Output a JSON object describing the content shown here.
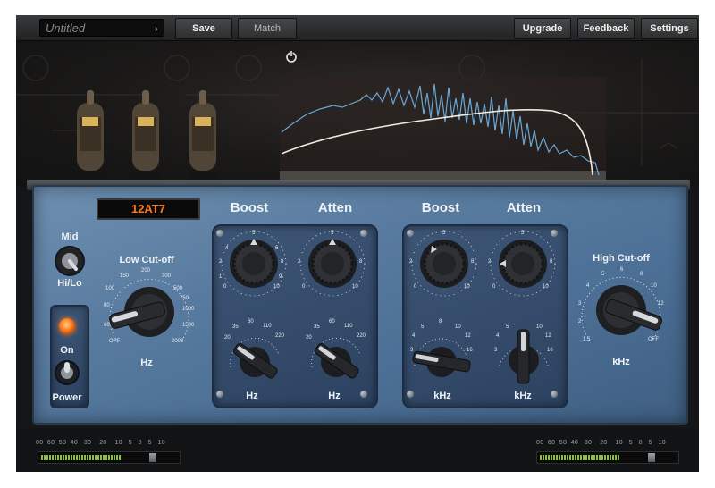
{
  "toolbar": {
    "preset_name": "Untitled",
    "save_label": "Save",
    "match_label": "Match",
    "upgrade_label": "Upgrade",
    "feedback_label": "Feedback",
    "settings_label": "Settings"
  },
  "tube_display": "12AT7",
  "mid_switch": {
    "top": "Mid",
    "bottom": "Hi/Lo"
  },
  "power": {
    "on_label": "On",
    "power_label": "Power"
  },
  "low_cutoff": {
    "title": "Low Cut-off",
    "unit": "Hz",
    "scale": [
      "OFF",
      "60",
      "80",
      "100",
      "150",
      "200",
      "300",
      "500",
      "750",
      "1000",
      "1500",
      "2000"
    ]
  },
  "high_cutoff": {
    "title": "High Cut-off",
    "unit": "kHz",
    "scale": [
      "1.5",
      "2",
      "3",
      "4",
      "5",
      "6",
      "8",
      "10",
      "12",
      "OFF"
    ]
  },
  "low_section": {
    "boost_label": "Boost",
    "atten_label": "Atten",
    "boost_unit": "Hz",
    "atten_unit": "Hz",
    "knob_scale": [
      "0",
      "1",
      "2",
      "3",
      "4",
      "5",
      "6",
      "7",
      "8",
      "9",
      "10"
    ],
    "freq_scale": [
      "20",
      "35",
      "60",
      "110",
      "220"
    ]
  },
  "high_section": {
    "boost_label": "Boost",
    "atten_label": "Atten",
    "boost_unit": "kHz",
    "atten_unit": "kHz",
    "knob_scale": [
      "0",
      "1",
      "2",
      "3",
      "4",
      "5",
      "6",
      "7",
      "8",
      "9",
      "10"
    ],
    "freq_scale_boost": [
      "3",
      "4",
      "5",
      "8",
      "10",
      "12",
      "16"
    ],
    "freq_scale_atten": [
      "3",
      "4",
      "5",
      "10",
      "12",
      "16"
    ]
  },
  "meters": {
    "scale": [
      "00",
      "60",
      "50",
      "40",
      "30",
      "20",
      "10",
      "5",
      "0",
      "5",
      "10"
    ],
    "input_level": 0.75,
    "output_level": 0.75
  },
  "colors": {
    "accent_orange": "#ff7a1a",
    "plate_blue": "#587b9f",
    "meter_green": "#8ac23a",
    "analyzer_blue": "#6aa8d6"
  }
}
